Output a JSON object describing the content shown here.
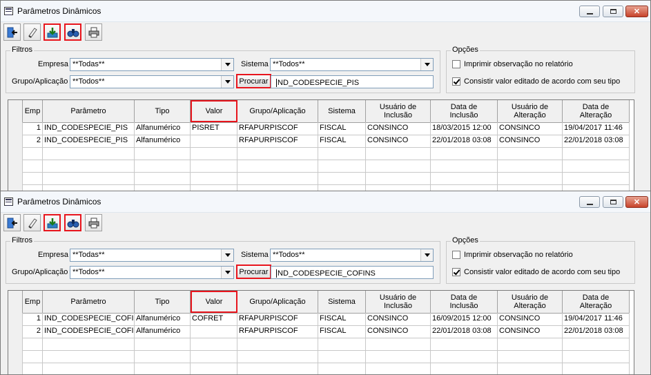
{
  "columns": [
    "Emp",
    "Parâmetro",
    "Tipo",
    "Valor",
    "Grupo/Aplicação",
    "Sistema",
    "Usuário de\nInclusão",
    "Data de\nInclusão",
    "Usuário de\nAlteração",
    "Data de\nAlteração"
  ],
  "windows": [
    {
      "title": "Parâmetros Dinâmicos",
      "filters": {
        "legend": "Filtros",
        "empresa_label": "Empresa",
        "empresa_value": "**Todas**",
        "sistema_label": "Sistema",
        "sistema_value": "**Todos**",
        "grupo_label": "Grupo/Aplicação",
        "grupo_value": "**Todos**",
        "procurar_label": "Procurar",
        "search_text": "IND_CODESPECIE_PIS"
      },
      "options": {
        "legend": "Opções",
        "opt1_label": "Imprimir observação no relatório",
        "opt1_checked": false,
        "opt2_label": "Consistir valor editado de acordo com seu tipo",
        "opt2_checked": true
      },
      "rows": [
        [
          "1",
          "IND_CODESPECIE_PIS",
          "Alfanumérico",
          "PISRET",
          "RFAPURPISCOF",
          "FISCAL",
          "CONSINCO",
          "18/03/2015 12:00",
          "CONSINCO",
          "19/04/2017 11:46"
        ],
        [
          "2",
          "IND_CODESPECIE_PIS",
          "Alfanumérico",
          "",
          "RFAPURPISCOF",
          "FISCAL",
          "CONSINCO",
          "22/01/2018 03:08",
          "CONSINCO",
          "22/01/2018 03:08"
        ]
      ]
    },
    {
      "title": "Parâmetros Dinâmicos",
      "filters": {
        "legend": "Filtros",
        "empresa_label": "Empresa",
        "empresa_value": "**Todas**",
        "sistema_label": "Sistema",
        "sistema_value": "**Todos**",
        "grupo_label": "Grupo/Aplicação",
        "grupo_value": "**Todos**",
        "procurar_label": "Procurar",
        "search_text": "IND_CODESPECIE_COFINS"
      },
      "options": {
        "legend": "Opções",
        "opt1_label": "Imprimir observação no relatório",
        "opt1_checked": false,
        "opt2_label": "Consistir valor editado de acordo com seu tipo",
        "opt2_checked": true
      },
      "rows": [
        [
          "1",
          "IND_CODESPECIE_COFINS",
          "Alfanumérico",
          "COFRET",
          "RFAPURPISCOF",
          "FISCAL",
          "CONSINCO",
          "16/09/2015 12:00",
          "CONSINCO",
          "19/04/2017 11:46"
        ],
        [
          "2",
          "IND_CODESPECIE_COFINS",
          "Alfanumérico",
          "",
          "RFAPURPISCOF",
          "FISCAL",
          "CONSINCO",
          "22/01/2018 03:08",
          "CONSINCO",
          "22/01/2018 03:08"
        ]
      ]
    }
  ],
  "toolbar_icons": [
    "exit-door-icon",
    "eraser-icon",
    "save-download-icon",
    "binoculars-search-icon",
    "printer-icon"
  ],
  "colors": {
    "highlight": "#e8141c",
    "close_button": "#c7432b",
    "border_blue": "#7f9db9"
  }
}
